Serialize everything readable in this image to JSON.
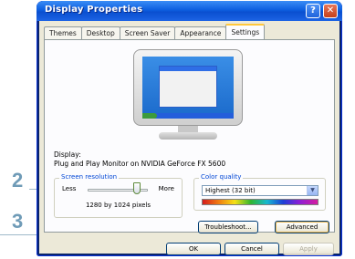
{
  "window": {
    "title": "Display Properties",
    "help_label": "?",
    "close_label": "✕"
  },
  "tabs": [
    {
      "label": "Themes"
    },
    {
      "label": "Desktop"
    },
    {
      "label": "Screen Saver"
    },
    {
      "label": "Appearance"
    },
    {
      "label": "Settings",
      "active": true
    }
  ],
  "display": {
    "label": "Display:",
    "value": "Plug and Play Monitor on NVIDIA GeForce FX 5600"
  },
  "resolution": {
    "legend": "Screen resolution",
    "less_label": "Less",
    "more_label": "More",
    "value_text": "1280 by 1024 pixels"
  },
  "color_quality": {
    "legend": "Color quality",
    "selected": "Highest (32 bit)"
  },
  "buttons": {
    "troubleshoot": "Troubleshoot...",
    "advanced": "Advanced",
    "ok": "OK",
    "cancel": "Cancel",
    "apply": "Apply"
  },
  "callouts": {
    "two": "2",
    "three": "3"
  },
  "colors": {
    "titlebar": "#0d5fe0",
    "callout": "#6f9bb7",
    "dialog_face": "#ece9d8"
  }
}
